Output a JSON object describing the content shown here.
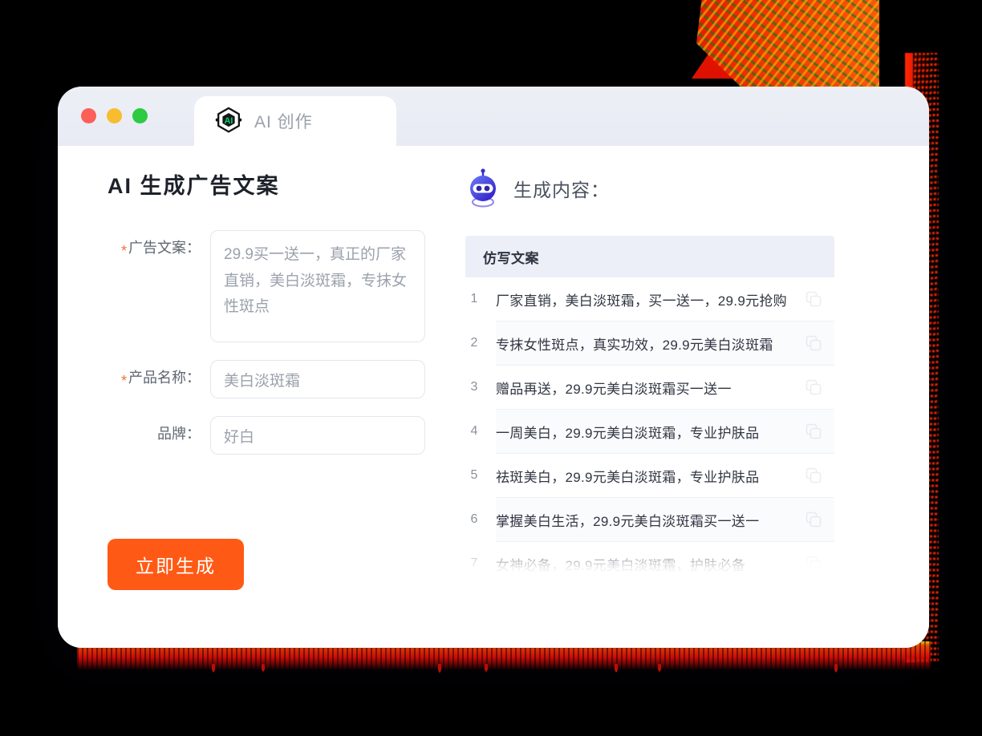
{
  "window": {
    "traffic_lights": [
      {
        "name": "close",
        "color": "#fc5f57"
      },
      {
        "name": "minimize",
        "color": "#f7bd2e"
      },
      {
        "name": "maximize",
        "color": "#2ccb41"
      }
    ],
    "tab": {
      "label": "AI 创作",
      "logo_text": "AI",
      "logo_icon": "ai-hexagon-logo",
      "logo_accent": "#00d46a"
    }
  },
  "left": {
    "page_title": "AI 生成广告文案",
    "fields": [
      {
        "label": "广告文案：",
        "required": true,
        "type": "textarea",
        "value": "29.9买一送一，真正的厂家直销，美白淡斑霜，专抹女性斑点"
      },
      {
        "label": "产品名称：",
        "required": true,
        "type": "input",
        "value": "美白淡斑霜"
      },
      {
        "label": "品牌：",
        "required": false,
        "type": "input",
        "value": "好白"
      }
    ],
    "submit_label": "立即生成",
    "submit_color": "#ff5a15"
  },
  "right": {
    "icon": "robot-icon",
    "heading": "生成内容：",
    "table": {
      "column_header": "仿写文案",
      "rows": [
        {
          "index": "1",
          "text": "厂家直销，美白淡斑霜，买一送一，29.9元抢购",
          "copy_icon": "copy-icon"
        },
        {
          "index": "2",
          "text": "专抹女性斑点，真实功效，29.9元美白淡斑霜",
          "copy_icon": "copy-icon"
        },
        {
          "index": "3",
          "text": "赠品再送，29.9元美白淡斑霜买一送一",
          "copy_icon": "copy-icon"
        },
        {
          "index": "4",
          "text": "一周美白，29.9元美白淡斑霜，专业护肤品",
          "copy_icon": "copy-icon"
        },
        {
          "index": "5",
          "text": "祛斑美白，29.9元美白淡斑霜，专业护肤品",
          "copy_icon": "copy-icon"
        },
        {
          "index": "6",
          "text": "掌握美白生活，29.9元美白淡斑霜买一送一",
          "copy_icon": "copy-icon"
        },
        {
          "index": "7",
          "text": "女神必备，29.9元美白淡斑霜，护肤必备",
          "copy_icon": "copy-icon"
        }
      ]
    }
  }
}
